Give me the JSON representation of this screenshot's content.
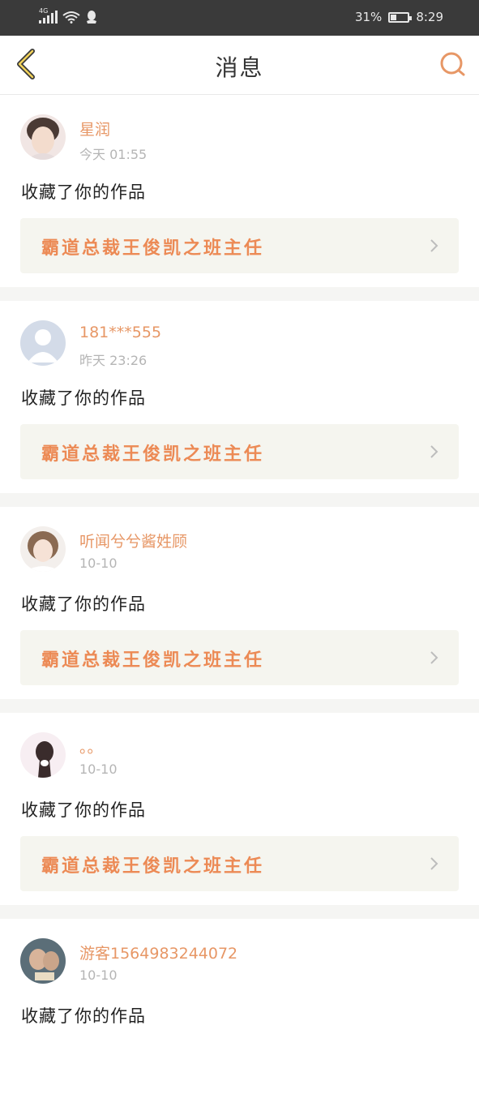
{
  "status_bar": {
    "network": "4G",
    "battery": "31%",
    "time": "8:29"
  },
  "header": {
    "title": "消息",
    "accent_color": "#e79766",
    "back_icon": "chevron-left-icon",
    "search_icon": "search-icon"
  },
  "notifications": [
    {
      "user": "星润",
      "time": "今天 01:55",
      "action": "收藏了你的作品",
      "work_title": "霸道总裁王俊凯之班主任"
    },
    {
      "user": "181***555",
      "time": "昨天 23:26",
      "action": "收藏了你的作品",
      "work_title": "霸道总裁王俊凯之班主任"
    },
    {
      "user": "听闻兮兮酱姓顾",
      "time": "10-10",
      "action": "收藏了你的作品",
      "work_title": "霸道总裁王俊凯之班主任"
    },
    {
      "user": "。。",
      "time": "10-10",
      "action": "收藏了你的作品",
      "work_title": "霸道总裁王俊凯之班主任"
    },
    {
      "user": "游客1564983244072",
      "time": "10-10",
      "action": "收藏了你的作品",
      "work_title": ""
    }
  ]
}
